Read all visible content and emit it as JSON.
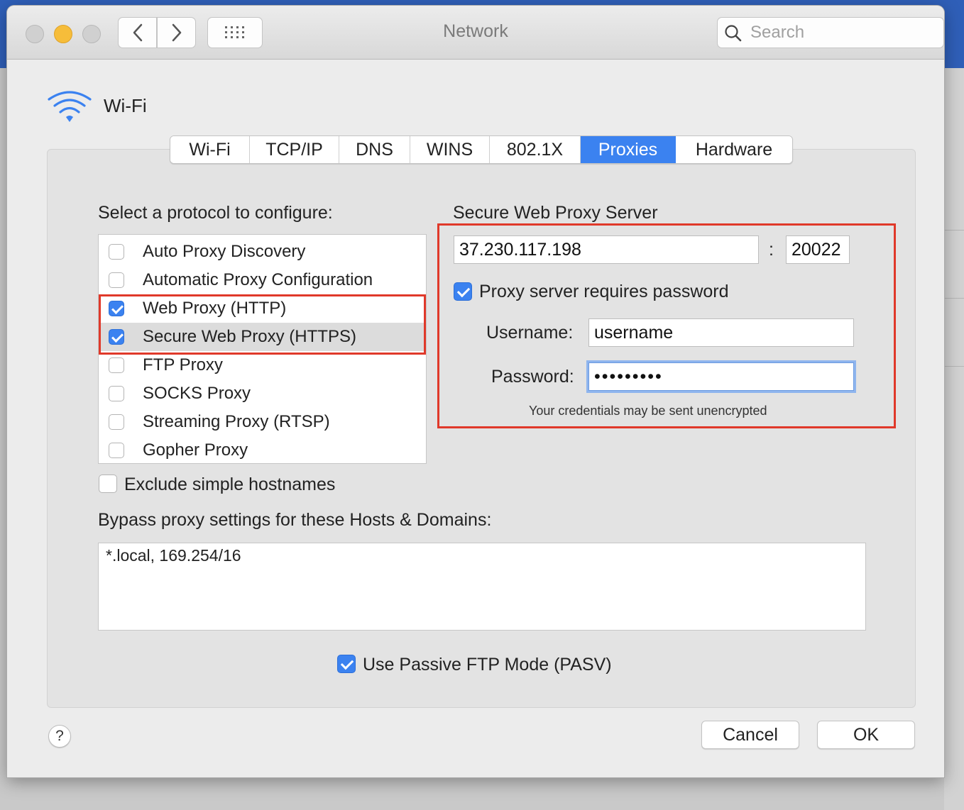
{
  "window": {
    "title": "Network"
  },
  "toolbar": {
    "search_placeholder": "Search"
  },
  "interface": {
    "name": "Wi-Fi"
  },
  "tabs": [
    {
      "label": "Wi-Fi"
    },
    {
      "label": "TCP/IP"
    },
    {
      "label": "DNS"
    },
    {
      "label": "WINS"
    },
    {
      "label": "802.1X"
    },
    {
      "label": "Proxies",
      "active": true
    },
    {
      "label": "Hardware"
    }
  ],
  "protocols": {
    "heading": "Select a protocol to configure:",
    "items": [
      {
        "label": "Auto Proxy Discovery",
        "checked": false
      },
      {
        "label": "Automatic Proxy Configuration",
        "checked": false
      },
      {
        "label": "Web Proxy (HTTP)",
        "checked": true
      },
      {
        "label": "Secure Web Proxy (HTTPS)",
        "checked": true,
        "selected": true
      },
      {
        "label": "FTP Proxy",
        "checked": false
      },
      {
        "label": "SOCKS Proxy",
        "checked": false
      },
      {
        "label": "Streaming Proxy (RTSP)",
        "checked": false
      },
      {
        "label": "Gopher Proxy",
        "checked": false
      }
    ]
  },
  "server": {
    "heading": "Secure Web Proxy Server",
    "address": "37.230.117.198",
    "separator": ":",
    "port": "20022",
    "requires_password_label": "Proxy server requires password",
    "requires_password": true,
    "username_label": "Username:",
    "username": "username",
    "password_label": "Password:",
    "password": "secretpwd",
    "warning": "Your credentials may be sent unencrypted"
  },
  "exclude_simple_label": "Exclude simple hostnames",
  "bypass": {
    "label": "Bypass proxy settings for these Hosts & Domains:",
    "value": "*.local, 169.254/16"
  },
  "passive_ftp_label": "Use Passive FTP Mode (PASV)",
  "buttons": {
    "help": "?",
    "cancel": "Cancel",
    "ok": "OK"
  },
  "colors": {
    "accent": "#3b82f0",
    "highlight": "#e0392a"
  }
}
